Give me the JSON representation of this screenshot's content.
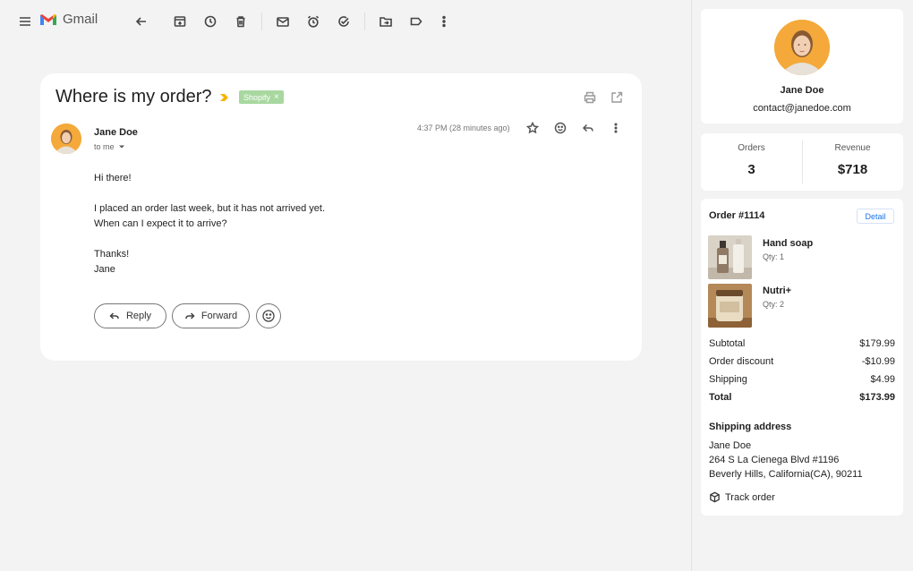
{
  "toolbar": {
    "app_name": "Gmail",
    "icons": [
      "menu-icon",
      "back-arrow-icon",
      "archive-icon",
      "snooze-clock-icon",
      "delete-icon",
      "mark-unread-icon",
      "alarm-icon",
      "add-task-icon",
      "move-to-icon",
      "label-icon",
      "more-vert-icon"
    ]
  },
  "email": {
    "subject": "Where is my order?",
    "label": "Shopify",
    "label_close": "×",
    "sender_name": "Jane Doe",
    "to": "to me",
    "timestamp": "4:37 PM (28 minutes ago)",
    "body": {
      "greeting": "Hi there!",
      "line1": "I placed an order last week, but it has not arrived yet.",
      "line2": "When can I expect it to arrive?",
      "thanks": "Thanks!",
      "sign": "Jane"
    },
    "reply_label": "Reply",
    "forward_label": "Forward"
  },
  "profile": {
    "name": "Jane Doe",
    "email": "contact@janedoe.com"
  },
  "stats": {
    "orders_label": "Orders",
    "orders_value": "3",
    "revenue_label": "Revenue",
    "revenue_value": "$718"
  },
  "order": {
    "title": "Order #1114",
    "detail_label": "Detail",
    "items": [
      {
        "name": "Hand soap",
        "qty": "Qty: 1"
      },
      {
        "name": "Nutri+",
        "qty": "Qty: 2"
      }
    ],
    "summary": [
      {
        "label": "Subtotal",
        "value": "$179.99"
      },
      {
        "label": "Order discount",
        "value": "-$10.99"
      },
      {
        "label": "Shipping",
        "value": "$4.99"
      },
      {
        "label": "Total",
        "value": "$173.99"
      }
    ],
    "shipping_title": "Shipping address",
    "shipping_lines": [
      "Jane Doe",
      "264 S La Cienega Blvd #1196",
      "Beverly Hills, California(CA), 90211"
    ],
    "track_label": "Track order"
  },
  "colors": {
    "label_chip": "#a8d8a0",
    "accent": "#1a73e8",
    "avatar_bg": "#f4a93a",
    "importance": "#f4b400"
  }
}
